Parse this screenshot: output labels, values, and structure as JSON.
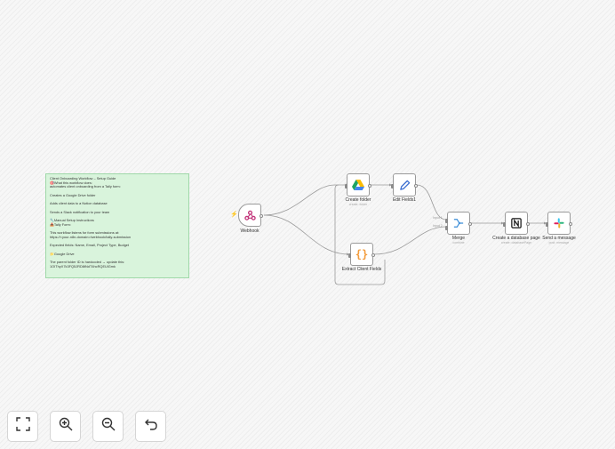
{
  "sticky_note": {
    "lines": [
      "Client Onboarding Workflow – Setup Guide",
      "🎯What this workflow does:",
      "automates client onboarding from a Tally form:",
      "",
      "Creates a Google Drive folder",
      "",
      "Adds client data to a Notion database",
      "",
      "Sends a Slack notification to your team",
      "",
      "🔧Manual Setup Instructions",
      "📥Tally Form:",
      "",
      "This workflow listens for form submissions at:",
      "https://<your-n8n-domain>/webhook/tally-submission",
      "",
      "Expected fields: Name, Email, Project Type, Budget",
      "",
      "📁Google Drive",
      "",
      "The parent folder ID is hardcoded → update this:",
      "1OIThyX7k3FQ5JRD8tNdT4hcRQEUlGmk"
    ]
  },
  "nodes": {
    "webhook": {
      "label": "Webhook",
      "subtitle": ""
    },
    "create_folder": {
      "label": "Create folder",
      "subtitle": "create: folder"
    },
    "edit_fields": {
      "label": "Edit Fields1",
      "subtitle": ""
    },
    "extract_client_fields": {
      "label": "Extract Client Fields",
      "subtitle": ""
    },
    "merge": {
      "label": "Merge",
      "subtitle": "combine"
    },
    "create_db_page": {
      "label": "Create a database page",
      "subtitle": "create: databasePage"
    },
    "send_message": {
      "label": "Send a message",
      "subtitle": "post: message"
    }
  },
  "edge_labels": {
    "input1": "Input 1",
    "input2": "Input 2"
  },
  "icons": {
    "webhook": "webhook-icon",
    "create_folder": "google-drive-icon",
    "edit_fields": "pen-icon",
    "extract": "code-braces-icon",
    "merge": "merge-icon",
    "notion": "notion-icon",
    "slack": "slack-icon"
  },
  "colors": {
    "accent": "#ff6d5a",
    "sticky_bg": "#d9f4dc",
    "merge_blue": "#3b8dd8",
    "code_orange": "#f39c3d"
  },
  "toolbar": {
    "fit": "fit-view-icon",
    "zoom_in": "zoom-in-icon",
    "zoom_out": "zoom-out-icon",
    "undo": "undo-icon"
  }
}
